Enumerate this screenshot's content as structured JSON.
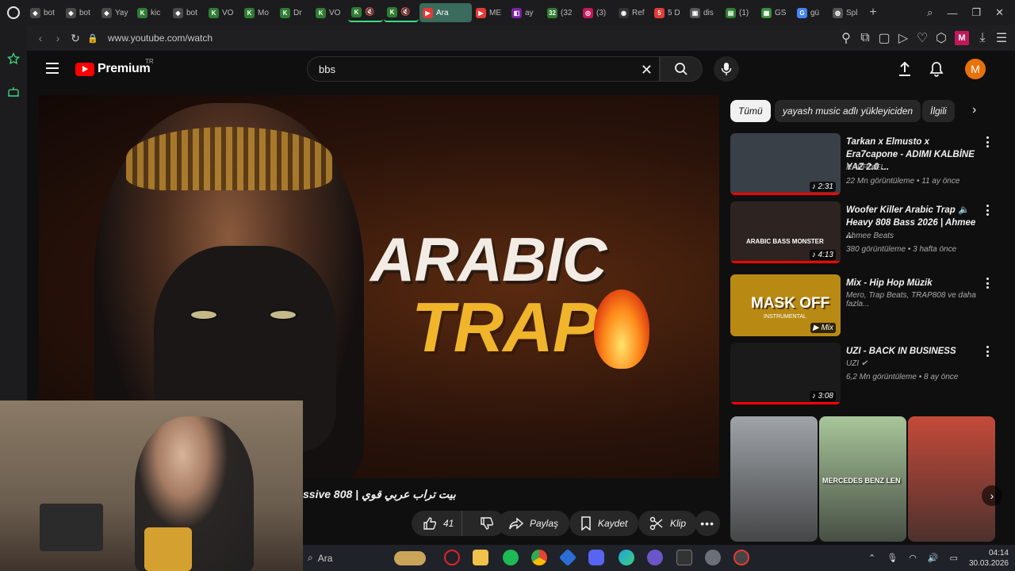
{
  "browser": {
    "tabs": [
      {
        "label": "bot",
        "fav_color": "#4a4a4a",
        "fav_glyph": "◆"
      },
      {
        "label": "bot",
        "fav_color": "#4a4a4a",
        "fav_glyph": "◆"
      },
      {
        "label": "Yay",
        "fav_color": "#4a4a4a",
        "fav_glyph": "◆"
      },
      {
        "label": "kic",
        "fav_color": "#2e7d32",
        "fav_glyph": "K"
      },
      {
        "label": "bot",
        "fav_color": "#4a4a4a",
        "fav_glyph": "◆"
      },
      {
        "label": "VO",
        "fav_color": "#2e7d32",
        "fav_glyph": "K"
      },
      {
        "label": "Mo",
        "fav_color": "#2e7d32",
        "fav_glyph": "K"
      },
      {
        "label": "Dr",
        "fav_color": "#2e7d32",
        "fav_glyph": "K"
      },
      {
        "label": "VO",
        "fav_color": "#2e7d32",
        "fav_glyph": "K"
      },
      {
        "label": "🔇",
        "fav_color": "#2e7d32",
        "fav_glyph": "K"
      },
      {
        "label": "🔇",
        "fav_color": "#2e7d32",
        "fav_glyph": "K"
      },
      {
        "label": "Ara",
        "fav_color": "#e53935",
        "fav_glyph": "▶"
      },
      {
        "label": "ME",
        "fav_color": "#e53935",
        "fav_glyph": "▶"
      },
      {
        "label": "ay",
        "fav_color": "#7b1fa2",
        "fav_glyph": "◧"
      },
      {
        "label": "(32",
        "fav_color": "#2e7d32",
        "fav_glyph": "32"
      },
      {
        "label": "(3)",
        "fav_color": "#c2185b",
        "fav_glyph": "◎"
      },
      {
        "label": "Ref",
        "fav_color": "#333333",
        "fav_glyph": "◉"
      },
      {
        "label": "5 D",
        "fav_color": "#e53935",
        "fav_glyph": "5"
      },
      {
        "label": "dis",
        "fav_color": "#555555",
        "fav_glyph": "▣"
      },
      {
        "label": "(1)",
        "fav_color": "#2e7d32",
        "fav_glyph": "▤"
      },
      {
        "label": "GS",
        "fav_color": "#388e3c",
        "fav_glyph": "▦"
      },
      {
        "label": "gü",
        "fav_color": "#4285f4",
        "fav_glyph": "G"
      },
      {
        "label": "Spl",
        "fav_color": "#555555",
        "fav_glyph": "◍"
      }
    ],
    "active_tab_index": 11,
    "url": "www.youtube.com/watch",
    "profile_letter": "M"
  },
  "youtube": {
    "logo_text": "Premium",
    "country": "TR",
    "search_value": "bbs",
    "avatar_letter": "M",
    "video_title_1": "ARABIC",
    "video_title_2": "TRAP",
    "title_text": "ssive 808 | بيت تراب عربي قوي",
    "actions": {
      "like_count": "41",
      "share_label": "Paylaş",
      "save_label": "Kaydet",
      "clip_label": "Klip"
    },
    "chips": [
      "Tümü",
      "yayash music adlı yükleyiciden",
      "İlgili"
    ],
    "recommendations": [
      {
        "title": "Tarkan x Elmusto x Era7capone - ADIMI KALBİNE YAZ 2.0 ...",
        "channel": "RAPPIXEL",
        "meta": "22 Mn görüntüleme • 11 ay önce",
        "duration": "♪ 2:31",
        "thumb_color": "#3a4048",
        "progress": 1.0
      },
      {
        "title": "Woofer Killer Arabic Trap 🔈 Heavy 808 Bass 2026 | Ahmee ...",
        "channel": "Ahmee Beats",
        "meta": "380 görüntüleme • 3 hafta önce",
        "duration": "♪ 4:13",
        "thumb_color": "#2d2320",
        "progress": 1.0
      },
      {
        "title": "Mix - Hip Hop Müzik",
        "channel": "Mero, Trap Beats, TRAP808 ve daha fazla...",
        "meta": "",
        "duration": "▶ Mix",
        "thumb_color": "#b88a14",
        "progress": 0
      },
      {
        "title": "UZI - BACK IN BUSINESS",
        "channel": "UZI ✔",
        "meta": "6,2 Mn görüntüleme • 8 ay önce",
        "duration": "♪ 3:08",
        "thumb_color": "#1a1a1a",
        "progress": 1.0
      }
    ],
    "rec2_thumb_text": "ARABIC BASS MONSTER",
    "rec3_thumb_text": "MASK OFF",
    "rec3_thumb_sub": "INSTRUMENTAL",
    "shorts": [
      {
        "color": "#9fa4a9"
      },
      {
        "color": "#a8c69a",
        "caption": "MERCEDES BENZ LEN"
      },
      {
        "color": "#c44a3a"
      }
    ]
  },
  "taskbar": {
    "search_label": "Ara",
    "time": "04:14",
    "date": "30.03.2026"
  }
}
